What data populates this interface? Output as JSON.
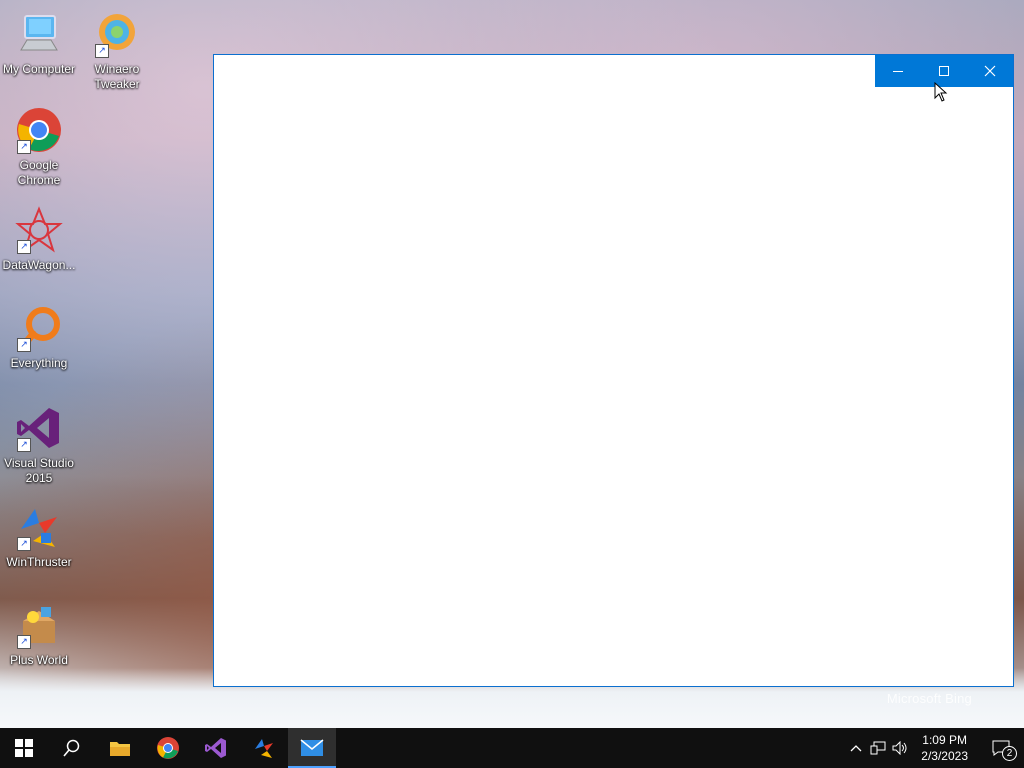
{
  "desktop": {
    "icons": [
      {
        "label": "My Computer",
        "icon": "computer-icon"
      },
      {
        "label": "Winaero Tweaker",
        "icon": "winaero-tweaker-icon"
      },
      {
        "label": "Google Chrome",
        "icon": "chrome-icon"
      },
      {
        "label": "DataWagon...",
        "icon": "datawagon-icon"
      },
      {
        "label": "Everything",
        "icon": "everything-search-icon"
      },
      {
        "label": "Visual Studio 2015",
        "icon": "visual-studio-icon"
      },
      {
        "label": "WinThruster",
        "icon": "winthruster-icon"
      },
      {
        "label": "Plus World",
        "icon": "plus-world-icon"
      }
    ],
    "wallpaper_caption": "Microsoft Bing"
  },
  "window": {
    "caption_color": "#0078d7",
    "buttons": [
      "minimize",
      "maximize",
      "close"
    ]
  },
  "taskbar": {
    "apps": [
      "start",
      "search",
      "file-explorer",
      "chrome",
      "visual-studio",
      "winthruster",
      "mail"
    ],
    "active_app": "mail",
    "time": "1:09 PM",
    "date": "2/3/2023",
    "notification_count": "2"
  }
}
